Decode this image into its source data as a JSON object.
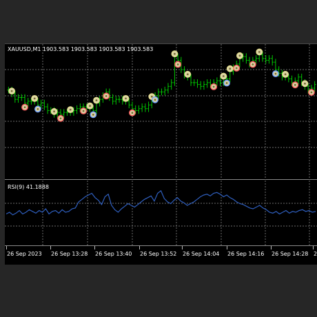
{
  "main_pane": {
    "title": "XAUUSD,M1  1903.583 1903.583 1903.583 1903.583"
  },
  "indicator_pane": {
    "title": "RSI(9) 41.1888"
  },
  "time_axis": {
    "labels": [
      "26 Sep 2023",
      "26 Sep 13:28",
      "26 Sep 13:40",
      "26 Sep 13:52",
      "26 Sep 14:04",
      "26 Sep 14:16",
      "26 Sep 14:28",
      "2"
    ]
  },
  "colors": {
    "background": "#000000",
    "bar_color": "#00c800",
    "rsi_line": "#2f5fbf",
    "grid": "#6e6e6e",
    "frame": "#262626"
  },
  "chart_data": {
    "type": "line",
    "xlabel": "",
    "ylabel": "",
    "grid": true,
    "price_series": {
      "name": "XAUUSD,M1",
      "note_type": "bar",
      "close": [
        1903.9,
        1903.7,
        1903.4,
        1903.5,
        1903.5,
        1903.2,
        1903.3,
        1903.3,
        1903.3,
        1903.1,
        1903.2,
        1903.0,
        1902.8,
        1902.8,
        1902.6,
        1902.7,
        1902.6,
        1902.7,
        1902.7,
        1902.7,
        1902.8,
        1902.9,
        1903.0,
        1903.0,
        1903.0,
        1902.9,
        1902.8,
        1903.2,
        1903.4,
        1903.6,
        1903.8,
        1903.5,
        1903.3,
        1903.4,
        1903.4,
        1903.3,
        1903.3,
        1903.1,
        1902.9,
        1902.8,
        1902.9,
        1903.0,
        1902.9,
        1903.1,
        1903.4,
        1903.6,
        1903.8,
        1903.8,
        1903.9,
        1904.1,
        1904.3,
        1905.7,
        1905.5,
        1905.0,
        1904.7,
        1904.6,
        1904.3,
        1904.3,
        1904.2,
        1904.1,
        1904.2,
        1904.3,
        1904.2,
        1904.3,
        1904.4,
        1904.3,
        1904.5,
        1904.5,
        1904.9,
        1905.1,
        1905.3,
        1905.6,
        1905.7,
        1905.5,
        1905.3,
        1905.5,
        1905.6,
        1905.8,
        1905.6,
        1905.5,
        1905.6,
        1905.4,
        1905.0,
        1904.8,
        1904.6,
        1904.6,
        1904.5,
        1904.3,
        1904.4,
        1904.6,
        1904.3,
        1904.1,
        1903.9,
        1904.0,
        1904.2
      ]
    },
    "rsi_series": {
      "name": "RSI(9)",
      "values": [
        38,
        40,
        37,
        39,
        42,
        38,
        40,
        43,
        41,
        39,
        42,
        40,
        44,
        38,
        41,
        42,
        39,
        43,
        40,
        41,
        44,
        45,
        52,
        55,
        58,
        60,
        62,
        57,
        54,
        49,
        58,
        61,
        48,
        43,
        40,
        44,
        47,
        50,
        48,
        46,
        49,
        52,
        55,
        57,
        59,
        53,
        62,
        65,
        56,
        52,
        50,
        54,
        57,
        53,
        51,
        48,
        50,
        52,
        55,
        58,
        60,
        61,
        59,
        62,
        63,
        61,
        58,
        60,
        57,
        55,
        52,
        50,
        49,
        47,
        45,
        44,
        46,
        48,
        45,
        43,
        40,
        39,
        41,
        38,
        40,
        42,
        39,
        41,
        40,
        42,
        43,
        41,
        42,
        40,
        41
      ]
    }
  }
}
